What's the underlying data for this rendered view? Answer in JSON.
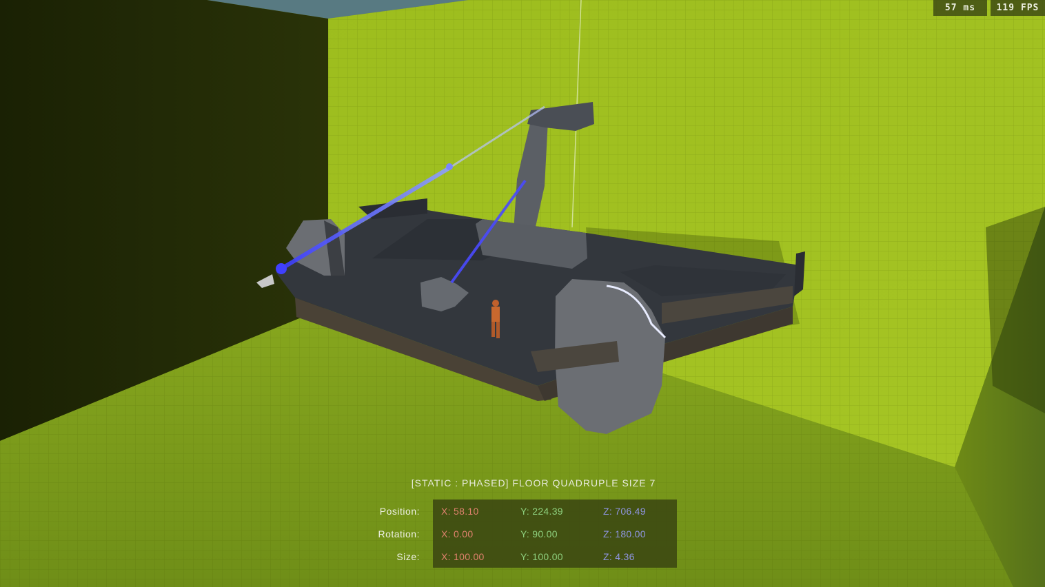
{
  "hud": {
    "latency": "57 ms",
    "fps": "119 FPS"
  },
  "selection": {
    "title": "[STATIC : PHASED] FLOOR QUADRUPLE SIZE 7",
    "rows": [
      {
        "label": "Position:",
        "x": "X: 58.10",
        "y": "Y: 224.39",
        "z": "Z: 706.49"
      },
      {
        "label": "Rotation:",
        "x": "X: 0.00",
        "y": "Y: 90.00",
        "z": "Z: 180.00"
      },
      {
        "label": "Size:",
        "x": "X: 100.00",
        "y": "Y: 100.00",
        "z": "Z: 4.36"
      }
    ]
  },
  "colors": {
    "wall_green": "#a3c220",
    "floor_green": "#7f9f1c",
    "left_wall_dark": "#232b06",
    "platform_dark": "#33373d",
    "beam_blue": "#5050ff",
    "axis_x": "#e0826e",
    "axis_y": "#8ed07e",
    "axis_z": "#8f95e2"
  }
}
